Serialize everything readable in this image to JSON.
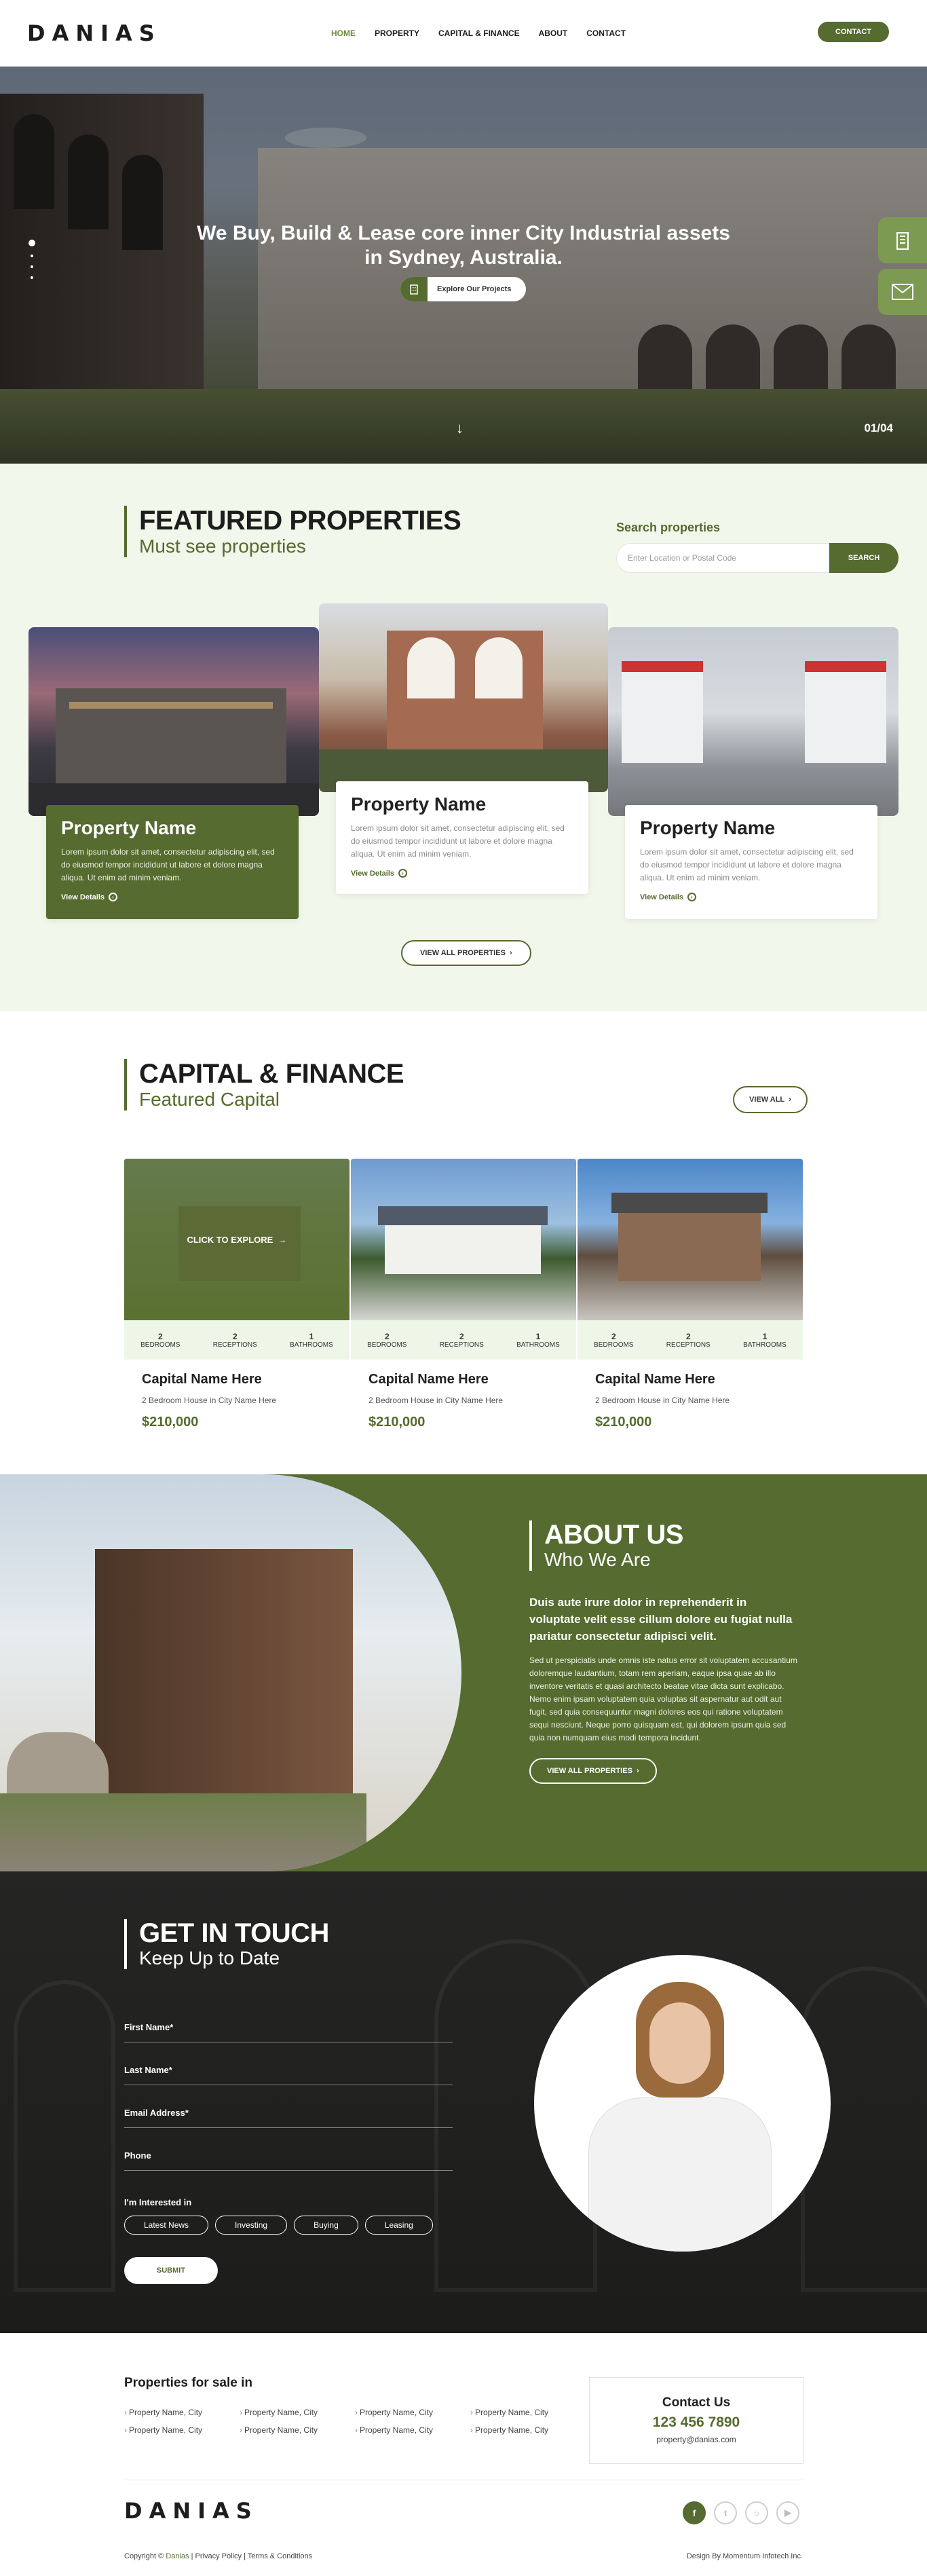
{
  "header": {
    "logo": "DANIAS",
    "nav": [
      "HOME",
      "PROPERTY",
      "CAPITAL & FINANCE",
      "ABOUT",
      "CONTACT"
    ],
    "active_nav": "HOME",
    "contact_button": "CONTACT"
  },
  "hero": {
    "title_line1": "We Buy, Build & Lease core inner City Industrial assets",
    "title_line2": "in Sydney, Australia.",
    "button": "Explore Our Projects",
    "counter": "01/04",
    "slide_count": 4,
    "active_slide": 1,
    "side_tools": [
      "building-icon",
      "mail-icon"
    ]
  },
  "featured": {
    "title": "FEATURED PROPERTIES",
    "subtitle": "Must see properties",
    "search_label": "Search properties",
    "search_placeholder": "Enter Location or Postal Code",
    "search_button": "SEARCH",
    "cards": [
      {
        "name": "Property Name",
        "text": "Lorem ipsum dolor sit amet, consectetur adipiscing elit, sed do eiusmod tempor incididunt ut labore et dolore magna aliqua. Ut enim ad minim veniam.",
        "link": "View Details"
      },
      {
        "name": "Property Name",
        "text": "Lorem ipsum dolor sit amet, consectetur adipiscing elit, sed do eiusmod tempor incididunt ut labore et dolore magna aliqua. Ut enim ad minim veniam.",
        "link": "View Details"
      },
      {
        "name": "Property Name",
        "text": "Lorem ipsum dolor sit amet, consectetur adipiscing elit, sed do eiusmod tempor incididunt ut labore et dolore magna aliqua. Ut enim ad minim veniam.",
        "link": "View Details"
      }
    ],
    "view_all": "VIEW ALL PROPERTIES"
  },
  "capital": {
    "title": "CAPITAL & FINANCE",
    "subtitle": "Featured Capital",
    "view_all": "VIEW ALL",
    "explore": "CLICK TO EXPLORE",
    "cards": [
      {
        "name": "Capital Name Here",
        "desc": "2 Bedroom House in City Name Here",
        "price": "$210,000",
        "bedrooms": "2",
        "receptions": "2",
        "bathrooms": "1"
      },
      {
        "name": "Capital Name Here",
        "desc": "2 Bedroom House in City Name Here",
        "price": "$210,000",
        "bedrooms": "2",
        "receptions": "2",
        "bathrooms": "1"
      },
      {
        "name": "Capital Name Here",
        "desc": "2 Bedroom House in City Name Here",
        "price": "$210,000",
        "bedrooms": "2",
        "receptions": "2",
        "bathrooms": "1"
      }
    ],
    "labels": {
      "bedrooms": "BEDROOMS",
      "receptions": "RECEPTIONS",
      "bathrooms": "BATHROOMS"
    }
  },
  "about": {
    "title": "ABOUT US",
    "subtitle": "Who We Are",
    "lead": "Duis aute irure dolor in reprehenderit in voluptate velit esse cillum dolore eu fugiat nulla pariatur consectetur adipisci velit.",
    "body": "Sed ut perspiciatis unde omnis iste natus error sit voluptatem accusantium doloremque laudantium, totam rem aperiam, eaque ipsa quae ab illo inventore veritatis et quasi architecto beatae vitae dicta sunt explicabo. Nemo enim ipsam voluptatem quia voluptas sit aspernatur aut odit aut fugit, sed quia consequuntur magni dolores eos qui ratione voluptatem sequi nesciunt. Neque porro quisquam est, qui dolorem ipsum quia sed quia non numquam eius modi tempora incidunt.",
    "button": "VIEW ALL PROPERTIES"
  },
  "contact_form": {
    "title": "GET IN TOUCH",
    "subtitle": "Keep Up to Date",
    "fields": [
      "First Name*",
      "Last Name*",
      "Email Address*",
      "Phone"
    ],
    "interest_label": "I'm Interested in",
    "chips": [
      "Latest News",
      "Investing",
      "Buying",
      "Leasing"
    ],
    "submit": "SUBMIT"
  },
  "footer": {
    "sale_title": "Properties for sale in",
    "sale_items": [
      "Property Name, City",
      "Property Name, City",
      "Property Name, City",
      "Property Name, City",
      "Property Name, City",
      "Property Name, City",
      "Property Name, City",
      "Property Name, City"
    ],
    "contact_title": "Contact Us",
    "phone": "123 456 7890",
    "email": "property@danias.com",
    "logo": "DANIAS",
    "copyright_prefix": "Copyright ©",
    "copyright_brand": "Danias",
    "privacy": "Privacy Policy",
    "terms": "Terms & Conditions",
    "design": "Design By Momentum Infotech Inc.",
    "socials": [
      "facebook-icon",
      "twitter-icon",
      "instagram-icon",
      "youtube-icon"
    ]
  },
  "colors": {
    "brand": "#556b2f",
    "light_bg": "#f1f7ea",
    "accent": "#7c9a52"
  }
}
